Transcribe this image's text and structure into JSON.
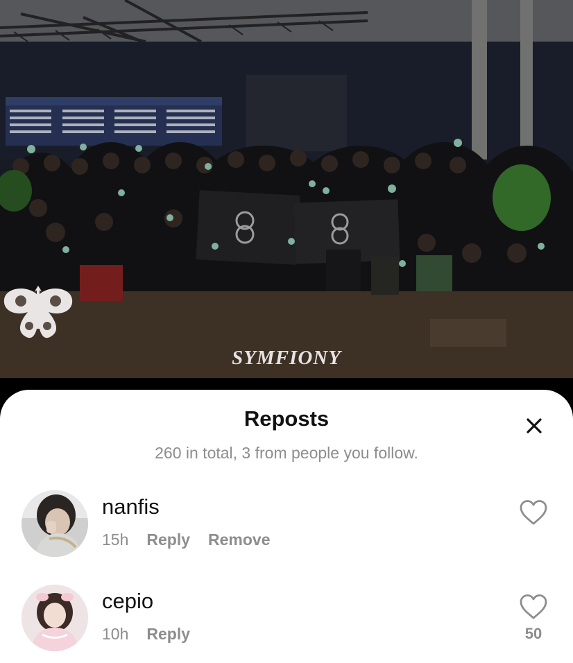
{
  "photo": {
    "watermark_text": "SYMFIONY",
    "banner_text": "SYMFIONY",
    "banner_small_text": "Symfiony"
  },
  "sheet": {
    "title": "Reposts",
    "subtitle": "260 in total, 3 from people you follow.",
    "close_icon": "close-icon"
  },
  "reposts": [
    {
      "username": "nanfis",
      "time": "15h",
      "actions": [
        "Reply",
        "Remove"
      ],
      "liked": false,
      "like_count": ""
    },
    {
      "username": "cepio",
      "time": "10h",
      "actions": [
        "Reply"
      ],
      "liked": false,
      "like_count": "50"
    }
  ],
  "colors": {
    "sheet_bg": "#ffffff",
    "title": "#111111",
    "secondary_text": "#8d8d8d",
    "watermark": "#e7e3e3"
  }
}
